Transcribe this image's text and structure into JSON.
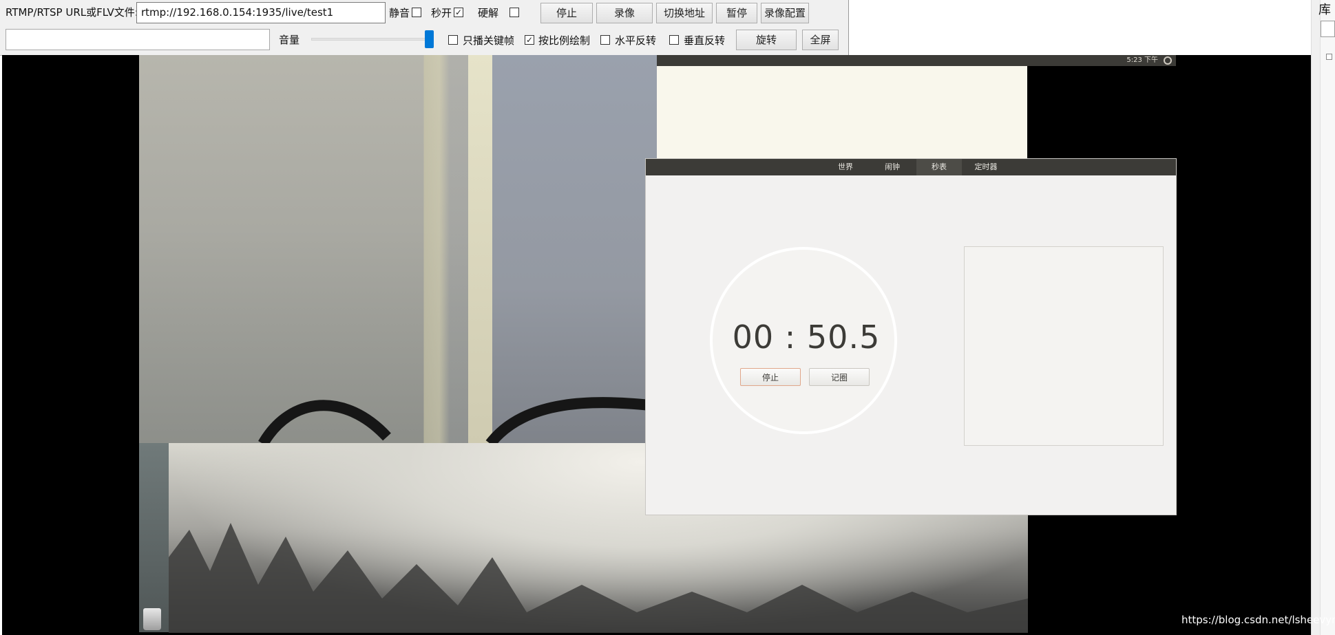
{
  "toolbar": {
    "url_label": "RTMP/RTSP URL或FLV文件:",
    "url_value": "rtmp://192.168.0.154:1935/live/test1",
    "mute_label": "静音",
    "mute_checked": false,
    "instant_open_label": "秒开",
    "instant_open_checked": true,
    "hw_decode_label": "硬解",
    "hw_decode_checked": false,
    "stop_btn": "停止",
    "record_btn": "录像",
    "switch_url_btn": "切换地址",
    "pause_btn": "暂停",
    "record_config_btn": "录像配置",
    "volume_label": "音量",
    "volume_level": 1.0,
    "keyframe_only_label": "只播关键帧",
    "keyframe_only_checked": false,
    "keep_ratio_label": "按比例绘制",
    "keep_ratio_checked": true,
    "flip_h_label": "水平反转",
    "flip_h_checked": false,
    "flip_v_label": "垂直反转",
    "flip_v_checked": false,
    "rotate_btn": "旋转",
    "fullscreen_btn": "全屏"
  },
  "right_panel": {
    "title": "库"
  },
  "video": {
    "topbar_status": "5:23 下午",
    "clock_tabs": [
      "世界",
      "闹钟",
      "秒表",
      "定时器"
    ],
    "active_tab": "秒表",
    "stopwatch_time": "00 : 50.5",
    "stopwatch_stop": "停止",
    "stopwatch_lap": "记圈"
  },
  "watermark": "https://blog.csdn.net/lsheevyng",
  "colors": {
    "accent": "#0078d7",
    "ubuntu_panel": "#3c3b37"
  }
}
